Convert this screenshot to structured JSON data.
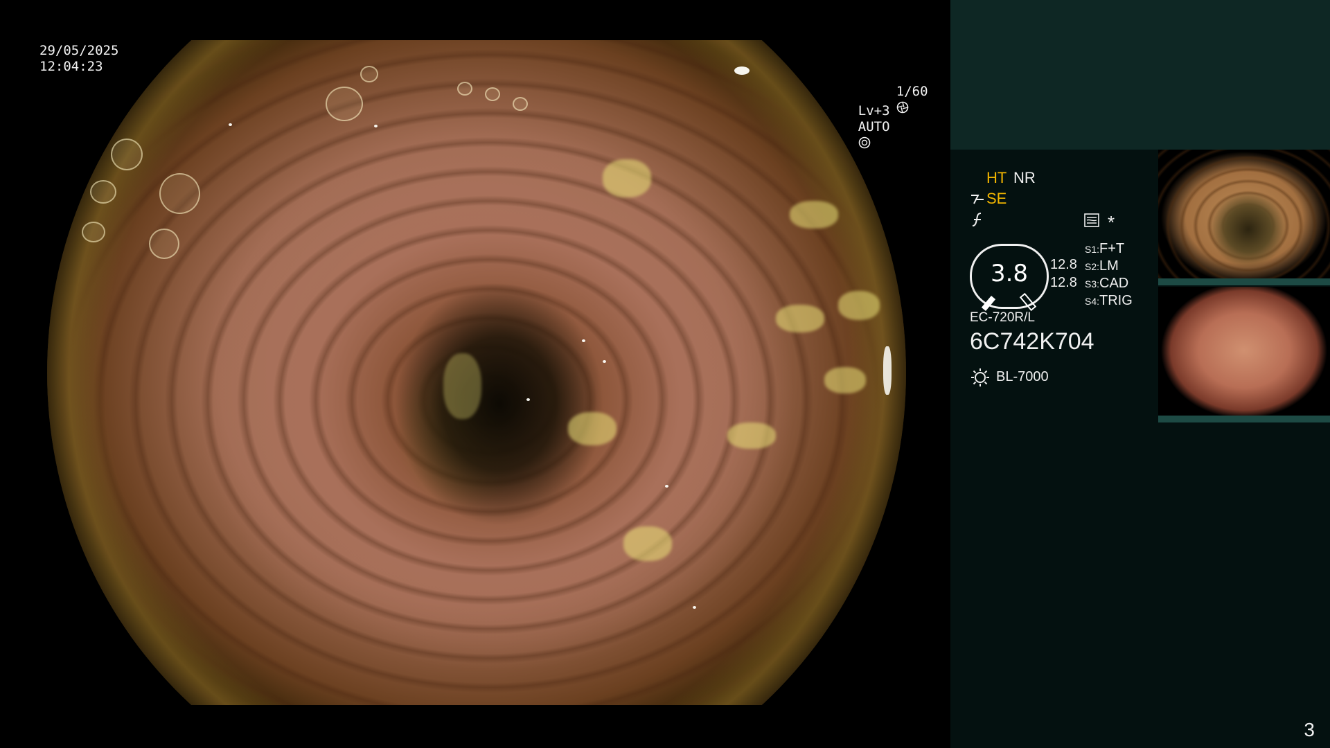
{
  "overlay": {
    "date": "29/05/2025",
    "time": "12:04:23",
    "shutter": "1/60",
    "level": "Lv+3",
    "iris_mode": "AUTO"
  },
  "panel": {
    "ht": "HT",
    "nr": "NR",
    "se": "SE",
    "snapshot_mark": "*",
    "gauge_value": "3.8",
    "gauge_readout_1": "12.8",
    "gauge_readout_2": "12.8",
    "switches": [
      {
        "key": "S1:",
        "value": "F+T"
      },
      {
        "key": "S2:",
        "value": "LM"
      },
      {
        "key": "S3:",
        "value": "CAD"
      },
      {
        "key": "S4:",
        "value": "TRIG"
      }
    ],
    "scope_model": "EC-720R/L",
    "serial": "6C742K704",
    "light_source": "BL-7000"
  },
  "page_number": "3",
  "colors": {
    "accent_yellow": "#f0b400",
    "panel_bg": "#041110",
    "panel_top_bg": "#0e2724"
  }
}
